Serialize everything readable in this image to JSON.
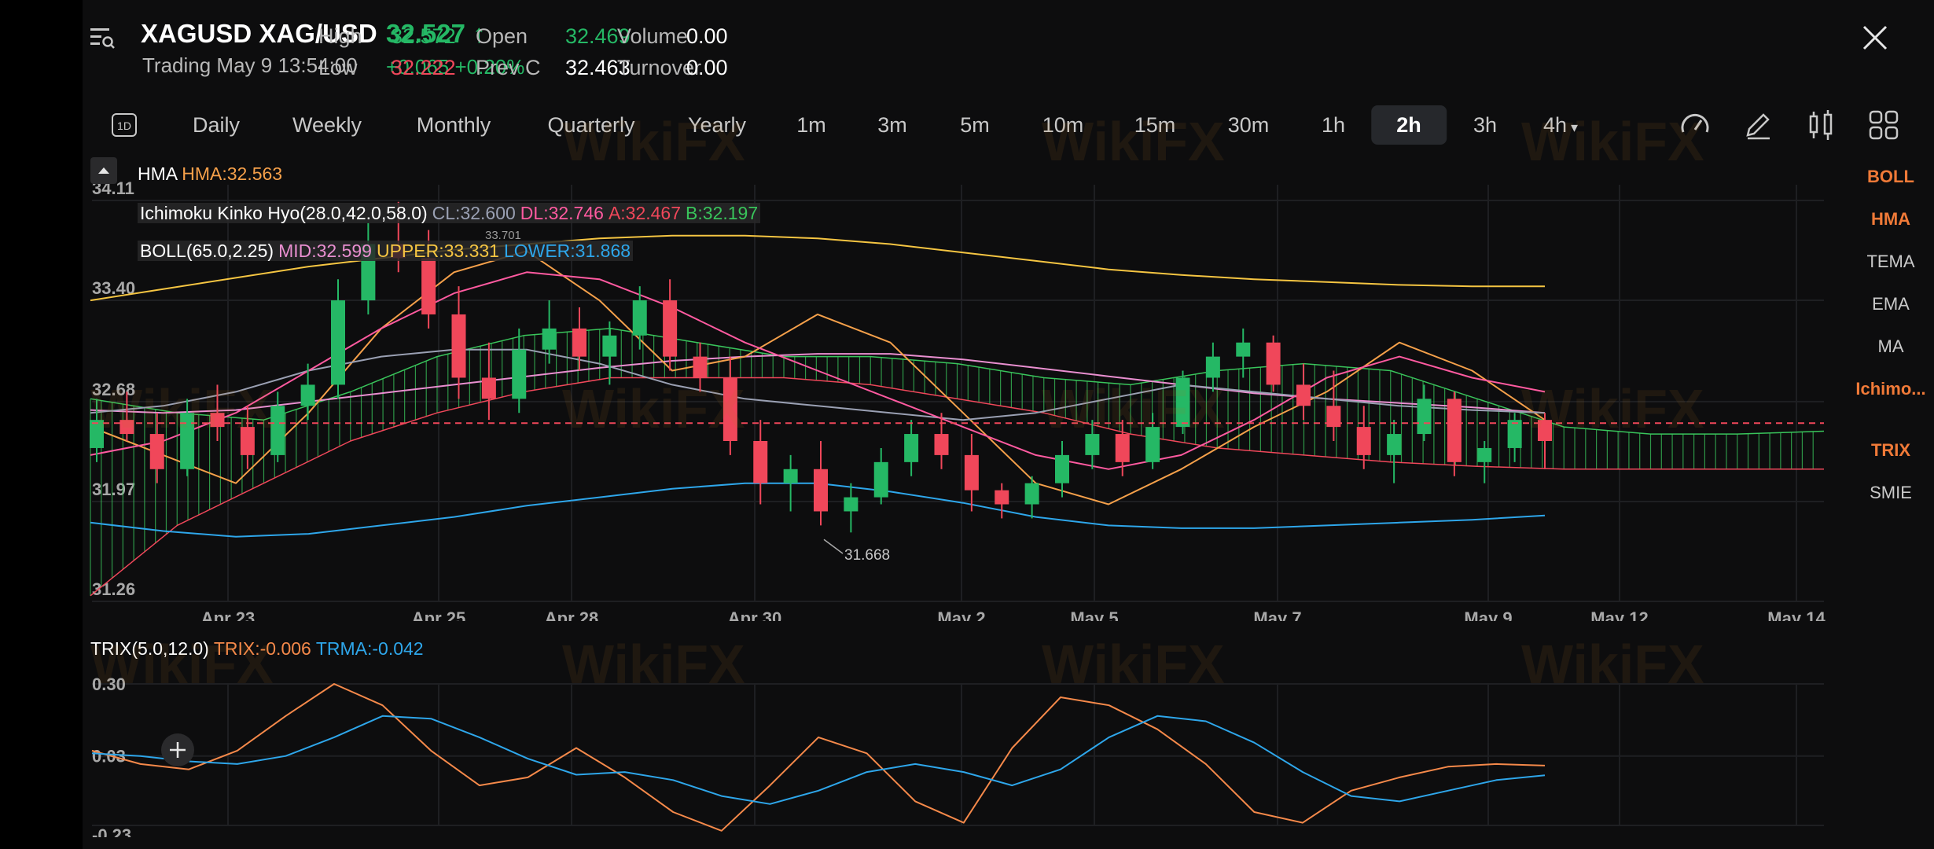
{
  "header": {
    "symbol": "XAGUSD XAG/USD",
    "price": "32.527",
    "status": "Trading  May 9 13:54:00",
    "change": "+0.065 +0.20%",
    "stats": [
      {
        "label": "High",
        "value": "32.572",
        "tone": "green"
      },
      {
        "label": "Open",
        "value": "32.469",
        "tone": "green"
      },
      {
        "label": "Volume",
        "value": "0.00",
        "tone": "white"
      },
      {
        "label": "Low",
        "value": "32.222",
        "tone": "red"
      },
      {
        "label": "Prev C",
        "value": "32.463",
        "tone": "white"
      },
      {
        "label": "Turnover",
        "value": "0.00",
        "tone": "white"
      }
    ]
  },
  "timeframes": [
    {
      "label": "Daily",
      "active": false
    },
    {
      "label": "Weekly",
      "active": false
    },
    {
      "label": "Monthly",
      "active": false
    },
    {
      "label": "Quarterly",
      "active": false
    },
    {
      "label": "Yearly",
      "active": false
    },
    {
      "label": "1m",
      "active": false
    },
    {
      "label": "3m",
      "active": false
    },
    {
      "label": "5m",
      "active": false
    },
    {
      "label": "10m",
      "active": false
    },
    {
      "label": "15m",
      "active": false
    },
    {
      "label": "30m",
      "active": false
    },
    {
      "label": "1h",
      "active": false
    },
    {
      "label": "2h",
      "active": true
    },
    {
      "label": "3h",
      "active": false
    },
    {
      "label": "4h",
      "active": false
    }
  ],
  "toolbar": {
    "period_badge": "1D",
    "icons": [
      "speedometer-icon",
      "pencil-icon",
      "candlestick-icon",
      "grid-icon"
    ]
  },
  "indicators": [
    {
      "label": "BOLL",
      "active": true
    },
    {
      "label": "HMA",
      "active": true
    },
    {
      "label": "TEMA",
      "active": false
    },
    {
      "label": "EMA",
      "active": false
    },
    {
      "label": "MA",
      "active": false
    },
    {
      "label": "Ichimo...",
      "active": true
    },
    {
      "label": "TRIX",
      "active": true
    },
    {
      "label": "SMIE",
      "active": false
    }
  ],
  "legends": {
    "hma_name": "HMA",
    "hma_value": "HMA:32.563",
    "ichimoku_name": "Ichimoku Kinko Hyo(28.0,42.0,58.0)",
    "ichimoku_cl": "CL:32.600",
    "ichimoku_dl": "DL:32.746",
    "ichimoku_a": "A:32.467",
    "ichimoku_b": "B:32.197",
    "boll_name": "BOLL(65.0,2.25)",
    "boll_mid": "MID:32.599",
    "boll_upper": "UPPER:33.331",
    "boll_lower": "LOWER:31.868",
    "trix_name": "TRIX(5.0,12.0)",
    "trix_value": "TRIX:-0.006",
    "trma_value": "TRMA:-0.042"
  },
  "watermark": "WikiFX",
  "colors": {
    "up": "#25b865",
    "down": "#f0475a",
    "boll_mid": "#e98fd0",
    "boll_upper": "#f5c542",
    "boll_lower": "#2ea6ea",
    "hma": "#f5a04a",
    "ichimoku_cl": "#9aa0b3",
    "ichimoku_dl": "#ff5aa0",
    "ichimoku_a": "#f0475a",
    "ichimoku_b": "#39c45b",
    "trix": "#f5894a",
    "trma": "#2ea6ea",
    "accent": "#f07a38"
  },
  "chart_data": [
    {
      "type": "candlestick",
      "ylim": [
        31.26,
        34.11
      ],
      "y_ticks": [
        "34.11",
        "33.40",
        "32.68",
        "31.97",
        "31.26"
      ],
      "x_ticks": [
        "Apr 23",
        "Apr 25",
        "Apr 28",
        "Apr 30",
        "May 2",
        "May 5",
        "May 7",
        "May 9",
        "May 12",
        "May 14"
      ],
      "annotations": [
        "31.668",
        "33.701"
      ],
      "last_price": 32.527,
      "candles_ohlc": [
        [
          32.35,
          32.7,
          32.25,
          32.55
        ],
        [
          32.55,
          32.75,
          32.4,
          32.45
        ],
        [
          32.45,
          32.6,
          32.1,
          32.2
        ],
        [
          32.2,
          32.7,
          32.15,
          32.6
        ],
        [
          32.6,
          32.8,
          32.4,
          32.5
        ],
        [
          32.5,
          32.65,
          32.2,
          32.3
        ],
        [
          32.3,
          32.75,
          32.25,
          32.65
        ],
        [
          32.65,
          32.95,
          32.55,
          32.8
        ],
        [
          32.8,
          33.55,
          32.7,
          33.4
        ],
        [
          33.4,
          33.95,
          33.3,
          33.8
        ],
        [
          33.8,
          34.1,
          33.6,
          33.7
        ],
        [
          33.7,
          33.9,
          33.2,
          33.3
        ],
        [
          33.3,
          33.5,
          32.7,
          32.85
        ],
        [
          32.85,
          33.1,
          32.55,
          32.7
        ],
        [
          32.7,
          33.2,
          32.6,
          33.05
        ],
        [
          33.05,
          33.4,
          32.95,
          33.2
        ],
        [
          33.2,
          33.35,
          32.9,
          33.0
        ],
        [
          33.0,
          33.25,
          32.8,
          33.15
        ],
        [
          33.15,
          33.5,
          33.05,
          33.4
        ],
        [
          33.4,
          33.55,
          32.9,
          33.0
        ],
        [
          33.0,
          33.1,
          32.75,
          32.85
        ],
        [
          32.85,
          33.0,
          32.3,
          32.4
        ],
        [
          32.4,
          32.55,
          31.95,
          32.1
        ],
        [
          32.1,
          32.3,
          31.9,
          32.2
        ],
        [
          32.2,
          32.4,
          31.8,
          31.9
        ],
        [
          31.9,
          32.1,
          31.75,
          32.0
        ],
        [
          32.0,
          32.35,
          31.95,
          32.25
        ],
        [
          32.25,
          32.55,
          32.15,
          32.45
        ],
        [
          32.45,
          32.6,
          32.2,
          32.3
        ],
        [
          32.3,
          32.45,
          31.9,
          32.05
        ],
        [
          32.05,
          32.1,
          31.85,
          31.95
        ],
        [
          31.95,
          32.15,
          31.85,
          32.1
        ],
        [
          32.1,
          32.4,
          32.0,
          32.3
        ],
        [
          32.3,
          32.55,
          32.2,
          32.45
        ],
        [
          32.45,
          32.55,
          32.15,
          32.25
        ],
        [
          32.25,
          32.6,
          32.2,
          32.5
        ],
        [
          32.5,
          32.9,
          32.45,
          32.85
        ],
        [
          32.85,
          33.1,
          32.75,
          33.0
        ],
        [
          33.0,
          33.2,
          32.85,
          33.1
        ],
        [
          33.1,
          33.15,
          32.75,
          32.8
        ],
        [
          32.8,
          32.95,
          32.55,
          32.65
        ],
        [
          32.65,
          32.9,
          32.4,
          32.5
        ],
        [
          32.5,
          32.65,
          32.2,
          32.3
        ],
        [
          32.3,
          32.55,
          32.1,
          32.45
        ],
        [
          32.45,
          32.8,
          32.4,
          32.7
        ],
        [
          32.7,
          32.75,
          32.15,
          32.25
        ],
        [
          32.25,
          32.4,
          32.1,
          32.35
        ],
        [
          32.35,
          32.6,
          32.25,
          32.55
        ],
        [
          32.55,
          32.6,
          32.2,
          32.4
        ]
      ],
      "boll_upper_line": [
        33.4,
        33.48,
        33.56,
        33.64,
        33.7,
        33.76,
        33.8,
        33.84,
        33.86,
        33.86,
        33.84,
        33.8,
        33.74,
        33.68,
        33.62,
        33.58,
        33.55,
        33.53,
        33.51,
        33.5,
        33.5
      ],
      "boll_mid_line": [
        32.62,
        32.6,
        32.62,
        32.68,
        32.74,
        32.8,
        32.86,
        32.92,
        32.97,
        33.0,
        33.02,
        33.02,
        32.98,
        32.92,
        32.86,
        32.8,
        32.74,
        32.7,
        32.67,
        32.64,
        32.6
      ],
      "boll_lower_line": [
        31.82,
        31.76,
        31.72,
        31.74,
        31.8,
        31.86,
        31.94,
        32.0,
        32.06,
        32.1,
        32.1,
        32.04,
        31.96,
        31.86,
        31.8,
        31.78,
        31.78,
        31.8,
        31.82,
        31.84,
        31.87
      ],
      "hma_line": [
        32.5,
        32.3,
        32.1,
        32.6,
        33.2,
        33.6,
        33.75,
        33.4,
        32.9,
        33.0,
        33.3,
        33.1,
        32.6,
        32.1,
        31.95,
        32.2,
        32.5,
        32.75,
        33.1,
        32.9,
        32.55
      ],
      "ichimoku_cl_line": [
        32.6,
        32.65,
        32.75,
        32.9,
        33.0,
        33.05,
        33.05,
        32.95,
        32.8,
        32.7,
        32.65,
        32.6,
        32.55,
        32.6,
        32.7,
        32.8,
        32.75,
        32.7,
        32.65,
        32.62,
        32.6
      ],
      "ichimoku_dl_line": [
        32.3,
        32.4,
        32.6,
        32.9,
        33.2,
        33.45,
        33.6,
        33.55,
        33.35,
        33.1,
        32.9,
        32.7,
        32.5,
        32.3,
        32.2,
        32.3,
        32.55,
        32.85,
        33.0,
        32.85,
        32.75
      ],
      "ichimoku_span_a": [
        32.7,
        32.6,
        32.55,
        32.75,
        33.0,
        33.15,
        33.2,
        33.1,
        33.0,
        33.0,
        32.95,
        32.85,
        32.8,
        32.9,
        32.95,
        32.9,
        32.7,
        32.5,
        32.45,
        32.45,
        32.47
      ],
      "ichimoku_span_b": [
        31.3,
        31.8,
        32.1,
        32.4,
        32.6,
        32.75,
        32.85,
        32.85,
        32.85,
        32.8,
        32.7,
        32.6,
        32.45,
        32.35,
        32.3,
        32.25,
        32.22,
        32.2,
        32.2,
        32.2,
        32.2
      ]
    },
    {
      "type": "line",
      "title": "TRIX(5.0,12.0)",
      "ylim": [
        -0.23,
        0.3
      ],
      "y_ticks": [
        "0.30",
        "0.03",
        "-0.23"
      ],
      "series": [
        {
          "name": "TRIX",
          "values": [
            0.05,
            0.0,
            -0.02,
            0.05,
            0.18,
            0.3,
            0.22,
            0.05,
            -0.08,
            -0.05,
            0.06,
            -0.05,
            -0.18,
            -0.25,
            -0.08,
            0.1,
            0.04,
            -0.14,
            -0.22,
            0.06,
            0.25,
            0.22,
            0.13,
            0.0,
            -0.18,
            -0.22,
            -0.1,
            -0.05,
            -0.01,
            0.0,
            -0.006
          ]
        },
        {
          "name": "TRMA",
          "values": [
            0.04,
            0.03,
            0.01,
            0.0,
            0.03,
            0.1,
            0.18,
            0.17,
            0.1,
            0.02,
            -0.04,
            -0.03,
            -0.06,
            -0.12,
            -0.15,
            -0.1,
            -0.03,
            0.0,
            -0.03,
            -0.08,
            -0.02,
            0.1,
            0.18,
            0.16,
            0.08,
            -0.03,
            -0.12,
            -0.14,
            -0.1,
            -0.06,
            -0.042
          ]
        }
      ]
    }
  ]
}
